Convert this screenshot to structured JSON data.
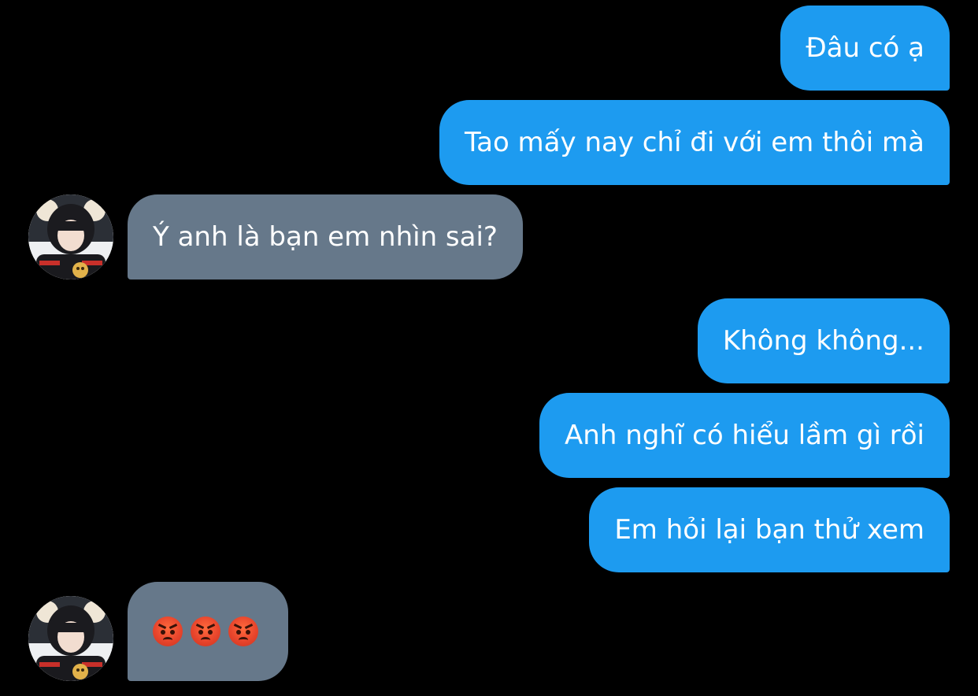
{
  "messages": [
    {
      "side": "out",
      "text": "Đâu có ạ"
    },
    {
      "side": "out",
      "text": "Tao mấy nay chỉ đi với em thôi mà"
    },
    {
      "side": "in",
      "text": "Ý anh là bạn em nhìn sai?"
    },
    {
      "side": "out",
      "text": "Không không..."
    },
    {
      "side": "out",
      "text": "Anh nghĩ có hiểu lầm gì rồi"
    },
    {
      "side": "out",
      "text": "Em hỏi lại bạn thử xem"
    },
    {
      "side": "in",
      "emoji": [
        "angry-face",
        "angry-face",
        "angry-face"
      ]
    }
  ],
  "colors": {
    "background": "#000000",
    "outgoing_bubble": "#1d9bf0",
    "incoming_bubble": "#66788a",
    "text": "#ffffff"
  },
  "icons": {
    "avatar": "profile-photo",
    "emoji": "angry-face-emoji"
  }
}
